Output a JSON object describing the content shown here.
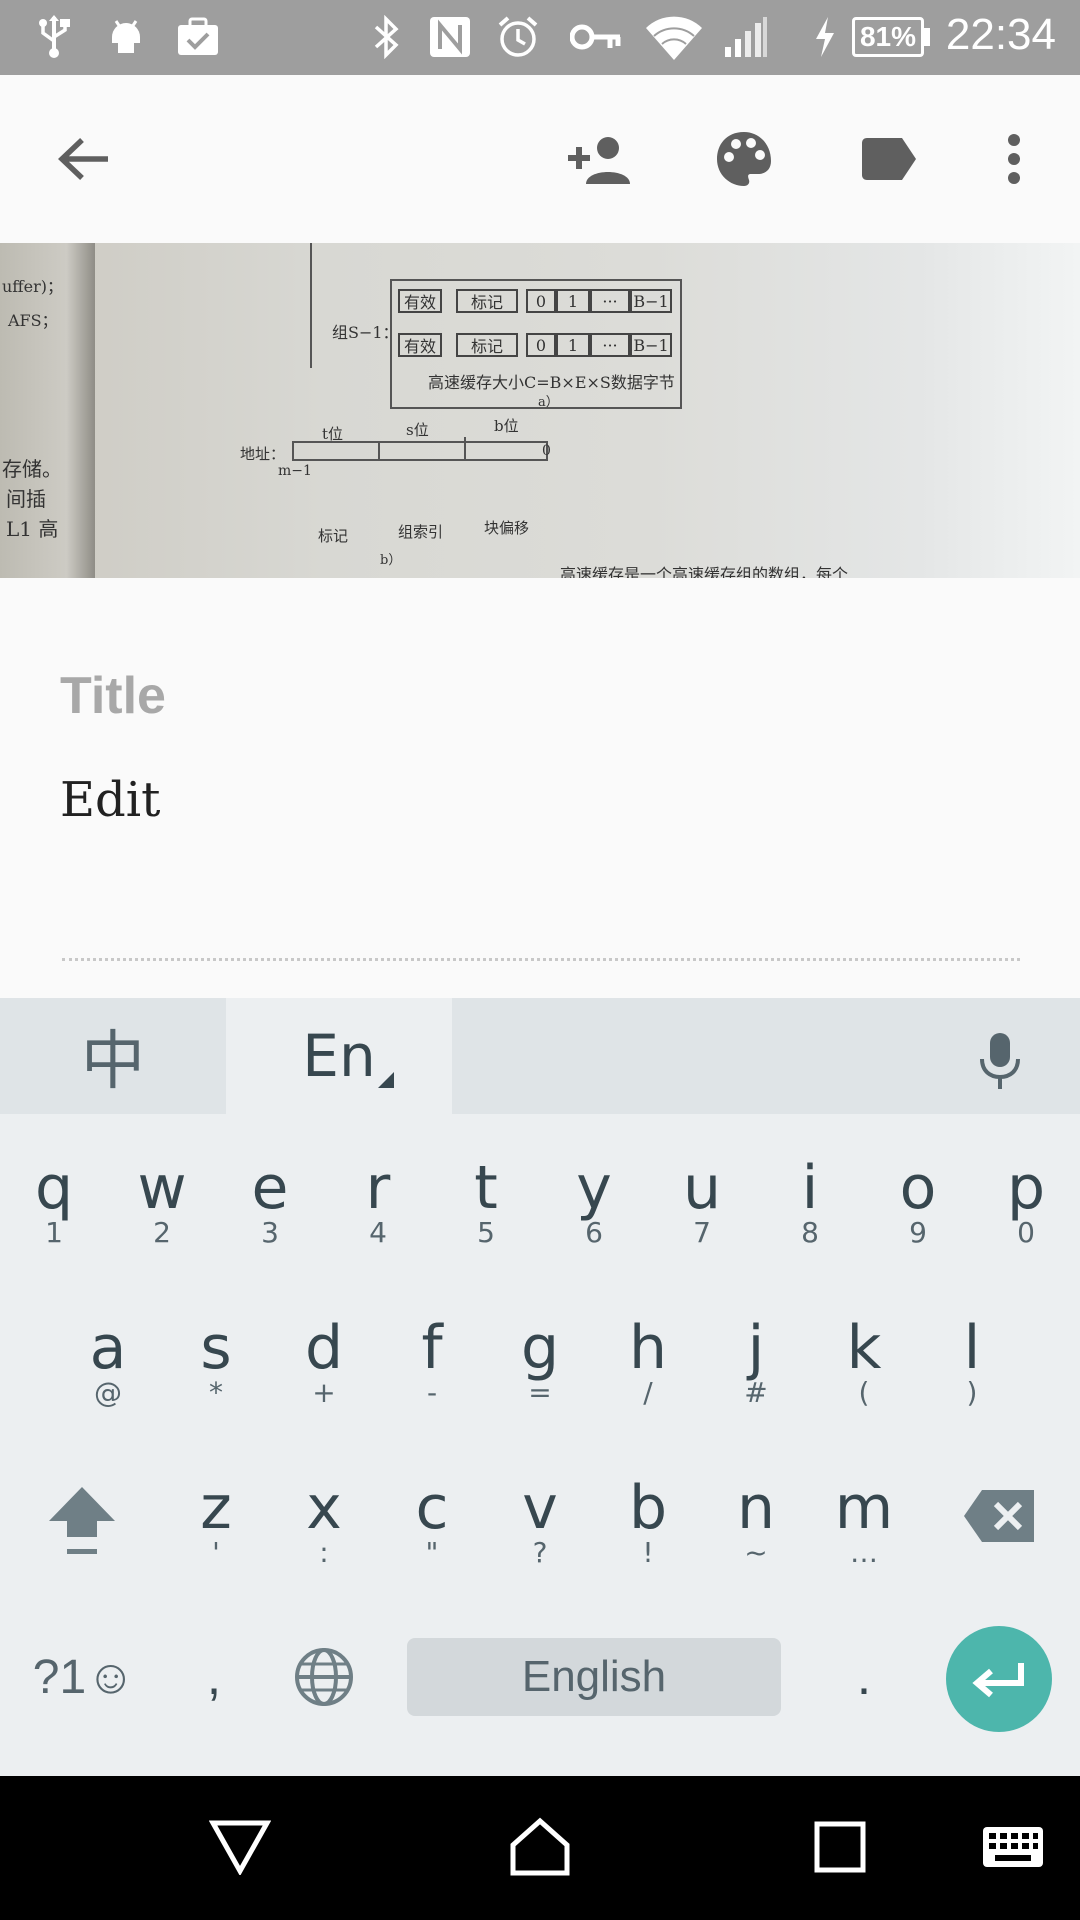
{
  "status_bar": {
    "icons": [
      "usb-icon",
      "android-debug-icon",
      "clipboard-check-icon",
      "bluetooth-icon",
      "nfc-icon",
      "alarm-icon",
      "vpn-key-icon",
      "wifi-icon",
      "signal-icon",
      "charging-icon"
    ],
    "battery": "81%",
    "time": "22:34"
  },
  "toolbar": {
    "icons": [
      "back-arrow-icon",
      "add-collaborator-icon",
      "palette-icon",
      "label-icon",
      "more-vert-icon"
    ]
  },
  "photo": {
    "left_margin": [
      "uffer)；",
      "AFS；",
      "存储。",
      "间插",
      "L1 高"
    ],
    "row_group": "组S−1：",
    "cell_valid": "有效",
    "cell_tag": "标记",
    "cell_b0": "0",
    "cell_b1": "1",
    "cell_dots": "···",
    "cell_bm1": "B−1",
    "size_caption": "高速缓存大小C=B×E×S数据字节",
    "caption_a": "a）",
    "addr_label": "地址：",
    "t_bits": "t位",
    "s_bits": "s位",
    "b_bits": "b位",
    "m_minus_1": "m−1",
    "zero": "0",
    "seg_tag": "标记",
    "seg_index": "组索引",
    "seg_offset": "块偏移",
    "caption_b": "b）",
    "bottom_text": "高速缓存是一个高速缓存组的数组，每个"
  },
  "editor": {
    "title_placeholder": "Title",
    "body_text": "Edit"
  },
  "keyboard": {
    "lang_chinese": "中",
    "lang_english": "En",
    "row1": [
      {
        "k": "q",
        "s": "1"
      },
      {
        "k": "w",
        "s": "2"
      },
      {
        "k": "e",
        "s": "3"
      },
      {
        "k": "r",
        "s": "4"
      },
      {
        "k": "t",
        "s": "5"
      },
      {
        "k": "y",
        "s": "6"
      },
      {
        "k": "u",
        "s": "7"
      },
      {
        "k": "i",
        "s": "8"
      },
      {
        "k": "o",
        "s": "9"
      },
      {
        "k": "p",
        "s": "0"
      }
    ],
    "row2": [
      {
        "k": "a",
        "s": "@"
      },
      {
        "k": "s",
        "s": "*"
      },
      {
        "k": "d",
        "s": "+"
      },
      {
        "k": "f",
        "s": "-"
      },
      {
        "k": "g",
        "s": "="
      },
      {
        "k": "h",
        "s": "/"
      },
      {
        "k": "j",
        "s": "#"
      },
      {
        "k": "k",
        "s": "("
      },
      {
        "k": "l",
        "s": ")"
      }
    ],
    "row3": [
      {
        "k": "z",
        "s": "'"
      },
      {
        "k": "x",
        "s": ":"
      },
      {
        "k": "c",
        "s": "\""
      },
      {
        "k": "v",
        "s": "?"
      },
      {
        "k": "b",
        "s": "!"
      },
      {
        "k": "n",
        "s": "~"
      },
      {
        "k": "m",
        "s": "…"
      }
    ],
    "symbols_label": "?1☺",
    "comma": ",",
    "period": ".",
    "space_label": "English"
  },
  "nav_bar": {
    "icons": [
      "back-triangle-icon",
      "home-icon",
      "recents-icon",
      "keyboard-switch-icon"
    ]
  },
  "colors": {
    "status_bar": "#9e9e9e",
    "enter_key": "#4db6ac",
    "keyboard_bg": "#eceff1",
    "title_placeholder": "#a8a8a8"
  }
}
